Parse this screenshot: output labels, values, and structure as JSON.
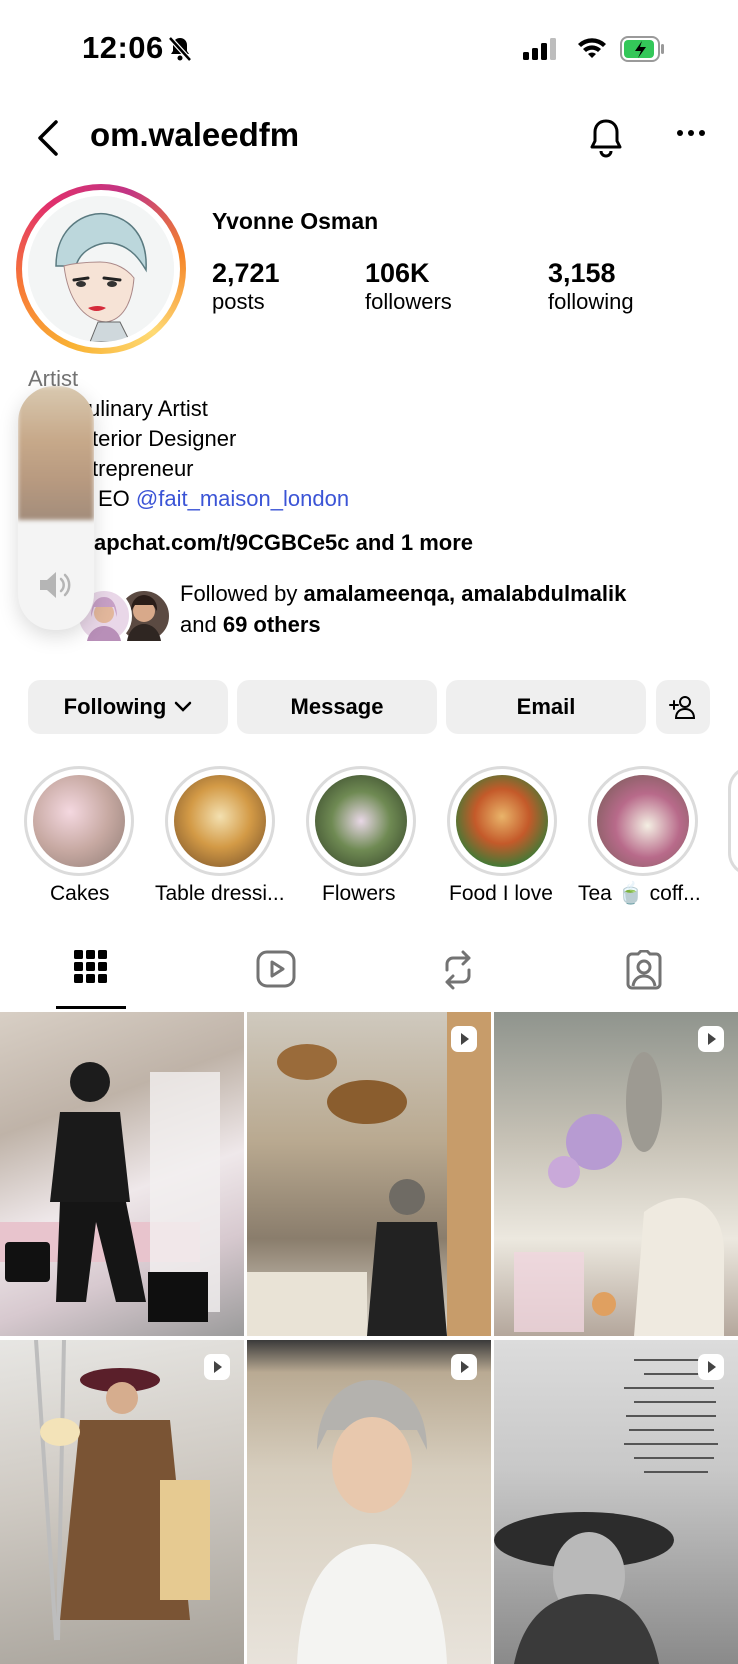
{
  "status_bar": {
    "time": "12:06"
  },
  "header": {
    "username": "om.waleedfm"
  },
  "profile": {
    "display_name": "Yvonne Osman",
    "stats": [
      {
        "value": "2,721",
        "label": "posts"
      },
      {
        "value": "106K",
        "label": "followers"
      },
      {
        "value": "3,158",
        "label": "following"
      }
    ],
    "category": "Artist",
    "bio_lines": [
      "ulinary Artist",
      "terior Designer",
      "trepreneur",
      "EO"
    ],
    "bio_mention": "@fait_maison_london",
    "link": "apchat.com/t/9CGBCe5c and 1 more",
    "followed_by": {
      "prefix": "Followed by ",
      "names": "amalameenqa, amalabdulmalik",
      "and": "and ",
      "others": "69 others"
    }
  },
  "buttons": {
    "following": "Following",
    "message": "Message",
    "email": "Email"
  },
  "highlights": [
    {
      "label": "Cakes"
    },
    {
      "label": "Table dressi..."
    },
    {
      "label": "Flowers"
    },
    {
      "label": "Food I love"
    },
    {
      "label": "Tea 🍵 coff..."
    }
  ],
  "tabs": [
    "posts-grid",
    "reels",
    "reposts",
    "tagged"
  ],
  "colors": {
    "mention": "#3b54d6",
    "button_bg": "#efefef",
    "battery_fill": "#34c759"
  }
}
